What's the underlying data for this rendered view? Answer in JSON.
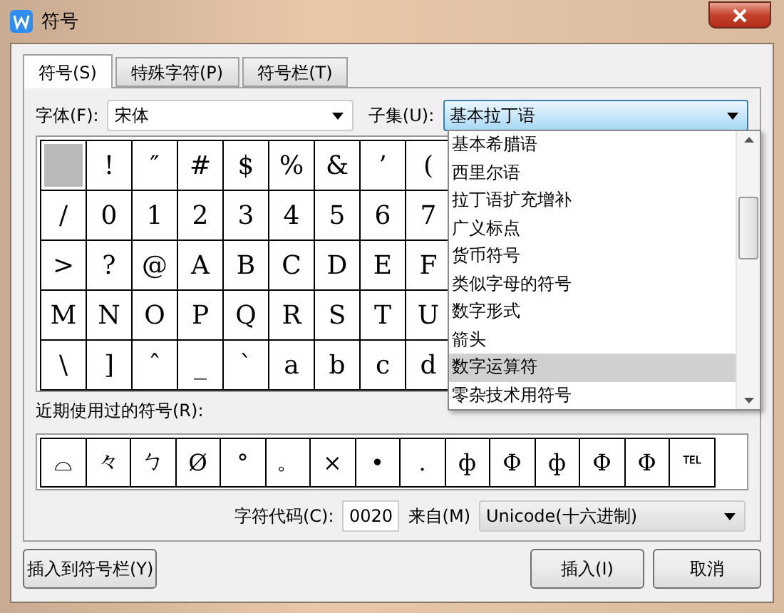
{
  "window": {
    "title": "符号"
  },
  "tabs": [
    {
      "label": "符号(S)",
      "selected": true
    },
    {
      "label": "特殊字符(P)",
      "selected": false
    },
    {
      "label": "符号栏(T)",
      "selected": false
    }
  ],
  "font": {
    "label": "字体(F):",
    "value": "宋体"
  },
  "subset": {
    "label": "子集(U):",
    "value": "基本拉丁语",
    "expanded": true,
    "options": [
      {
        "label": "基本希腊语",
        "selected": false
      },
      {
        "label": "西里尔语",
        "selected": false
      },
      {
        "label": "拉丁语扩充增补",
        "selected": false
      },
      {
        "label": "广义标点",
        "selected": false
      },
      {
        "label": "货币符号",
        "selected": false
      },
      {
        "label": "类似字母的符号",
        "selected": false
      },
      {
        "label": "数字形式",
        "selected": false
      },
      {
        "label": "箭头",
        "selected": false
      },
      {
        "label": "数字运算符",
        "selected": true
      },
      {
        "label": "零杂技术用符号",
        "selected": false
      }
    ]
  },
  "symbols": [
    [
      {
        "selected": true
      },
      {
        "char": "!",
        "selected": false
      },
      {
        "char": "″",
        "selected": false
      },
      {
        "char": "#",
        "selected": false
      },
      {
        "char": "$",
        "selected": false
      },
      {
        "char": "%",
        "selected": false
      },
      {
        "char": "&",
        "selected": false
      },
      {
        "char": "’",
        "selected": false
      },
      {
        "char": "(",
        "selected": false
      }
    ],
    [
      {
        "char": "/",
        "selected": false
      },
      {
        "char": "0",
        "selected": false
      },
      {
        "char": "1",
        "selected": false
      },
      {
        "char": "2",
        "selected": false
      },
      {
        "char": "3",
        "selected": false
      },
      {
        "char": "4",
        "selected": false
      },
      {
        "char": "5",
        "selected": false
      },
      {
        "char": "6",
        "selected": false
      },
      {
        "char": "7",
        "selected": false
      }
    ],
    [
      {
        "char": ">",
        "selected": false
      },
      {
        "char": "?",
        "selected": false
      },
      {
        "char": "@",
        "selected": false
      },
      {
        "char": "A",
        "selected": false
      },
      {
        "char": "B",
        "selected": false
      },
      {
        "char": "C",
        "selected": false
      },
      {
        "char": "D",
        "selected": false
      },
      {
        "char": "E",
        "selected": false
      },
      {
        "char": "F",
        "selected": false
      }
    ],
    [
      {
        "char": "M",
        "selected": false
      },
      {
        "char": "N",
        "selected": false
      },
      {
        "char": "O",
        "selected": false
      },
      {
        "char": "P",
        "selected": false
      },
      {
        "char": "Q",
        "selected": false
      },
      {
        "char": "R",
        "selected": false
      },
      {
        "char": "S",
        "selected": false
      },
      {
        "char": "T",
        "selected": false
      },
      {
        "char": "U",
        "selected": false
      }
    ],
    [
      {
        "char": "\\",
        "selected": false
      },
      {
        "char": "]",
        "selected": false
      },
      {
        "char": "ˆ",
        "selected": false
      },
      {
        "char": "_",
        "selected": false
      },
      {
        "char": "`",
        "selected": false
      },
      {
        "char": "a",
        "selected": false
      },
      {
        "char": "b",
        "selected": false
      },
      {
        "char": "c",
        "selected": false
      },
      {
        "char": "d",
        "selected": false
      }
    ]
  ],
  "recent": {
    "label": "近期使用过的符号(R):",
    "symbols": [
      "⌓",
      "々",
      "ㄅ",
      "Ø",
      "°",
      "。",
      "×",
      "•",
      ".",
      "ф",
      "Ф",
      "ф",
      "Ф",
      "Φ",
      "℡"
    ]
  },
  "code": {
    "label": "字符代码(C):",
    "value": "0020",
    "from_label": "来自(M)",
    "from_value": "Unicode(十六进制)"
  },
  "buttons": [
    "插入到符号栏(Y)",
    "插入(I)",
    "取消"
  ]
}
